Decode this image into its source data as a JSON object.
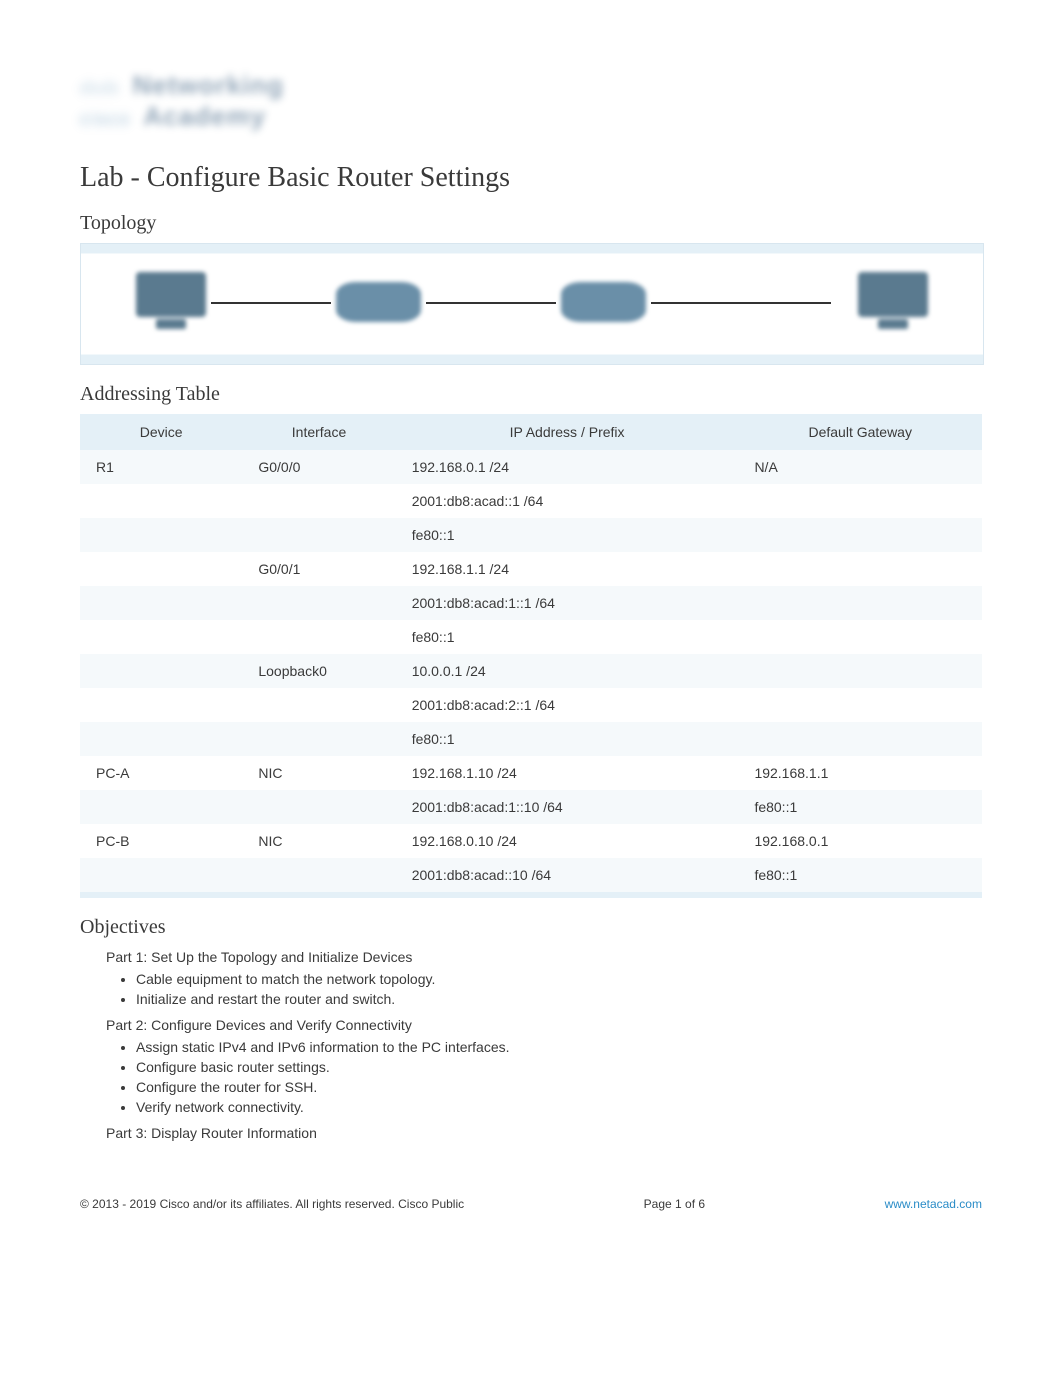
{
  "logo": {
    "line1": "Networking",
    "line2": "Academy",
    "brand_marks": "ılıılı"
  },
  "lab_title": "Lab - Configure Basic Router Settings",
  "sections": {
    "topology": "Topology",
    "addressing": "Addressing Table",
    "objectives": "Objectives"
  },
  "table": {
    "headers": {
      "device": "Device",
      "interface": "Interface",
      "ip": "IP Address / Prefix",
      "gateway": "Default Gateway"
    },
    "rows": [
      {
        "device": "R1",
        "iface": "G0/0/0",
        "ip": "192.168.0.1 /24",
        "gw": "N/A",
        "cls": "odd"
      },
      {
        "device": "",
        "iface": "",
        "ip": "2001:db8:acad::1 /64",
        "gw": "",
        "cls": "even"
      },
      {
        "device": "",
        "iface": "",
        "ip": "fe80::1",
        "gw": "",
        "cls": "odd"
      },
      {
        "device": "",
        "iface": "G0/0/1",
        "ip": "192.168.1.1 /24",
        "gw": "",
        "cls": "even"
      },
      {
        "device": "",
        "iface": "",
        "ip": "2001:db8:acad:1::1 /64",
        "gw": "",
        "cls": "odd"
      },
      {
        "device": "",
        "iface": "",
        "ip": "fe80::1",
        "gw": "",
        "cls": "even"
      },
      {
        "device": "",
        "iface": "Loopback0",
        "ip": "10.0.0.1 /24",
        "gw": "",
        "cls": "odd"
      },
      {
        "device": "",
        "iface": "",
        "ip": "2001:db8:acad:2::1 /64",
        "gw": "",
        "cls": "even"
      },
      {
        "device": "",
        "iface": "",
        "ip": "fe80::1",
        "gw": "",
        "cls": "odd"
      },
      {
        "device": "PC-A",
        "iface": "NIC",
        "ip": "192.168.1.10 /24",
        "gw": "192.168.1.1",
        "cls": "even"
      },
      {
        "device": "",
        "iface": "",
        "ip": "2001:db8:acad:1::10 /64",
        "gw": "fe80::1",
        "cls": "odd"
      },
      {
        "device": "PC-B",
        "iface": "NIC",
        "ip": "192.168.0.10 /24",
        "gw": "192.168.0.1",
        "cls": "even"
      },
      {
        "device": "",
        "iface": "",
        "ip": "2001:db8:acad::10 /64",
        "gw": "fe80::1",
        "cls": "odd"
      }
    ]
  },
  "objectives": {
    "part1": {
      "title": "Part 1: Set Up the Topology and Initialize Devices",
      "items": [
        "Cable equipment to match the network topology.",
        "Initialize and restart the router and switch."
      ]
    },
    "part2": {
      "title": "Part 2: Configure Devices and Verify Connectivity",
      "items": [
        "Assign static IPv4 and IPv6 information to the PC interfaces.",
        "Configure basic router settings.",
        "Configure the router for SSH.",
        "Verify network connectivity."
      ]
    },
    "part3": {
      "title": "Part 3: Display Router Information"
    }
  },
  "footer": {
    "copyright": "© 2013 - 2019 Cisco and/or its affiliates. All rights reserved. Cisco Public",
    "page": "Page 1 of 6",
    "link": "www.netacad.com"
  }
}
